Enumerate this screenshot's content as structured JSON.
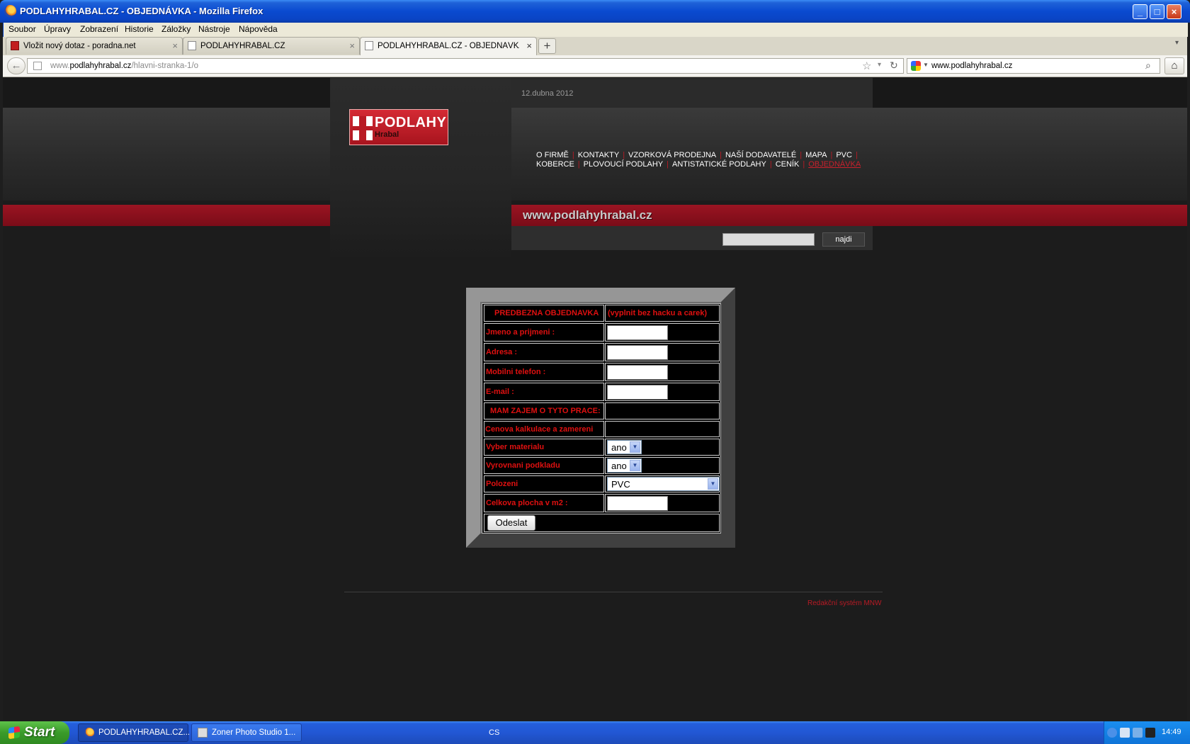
{
  "window": {
    "title": "PODLAHYHRABAL.CZ - OBJEDNÁVKA - Mozilla Firefox",
    "buttons": {
      "minimize": "_",
      "maximize": "□",
      "close": "×"
    }
  },
  "menubar": [
    "Soubor",
    "Úpravy",
    "Zobrazení",
    "Historie",
    "Záložky",
    "Nástroje",
    "Nápověda"
  ],
  "tabs": [
    {
      "label": "Vložit nový dotaz - poradna.net",
      "close": "×"
    },
    {
      "label": "PODLAHYHRABAL.CZ",
      "close": "×"
    },
    {
      "label": "PODLAHYHRABAL.CZ - OBJEDNÁVKA",
      "close": "×"
    }
  ],
  "newtab_label": "+",
  "navbar": {
    "url_prefix": "www.",
    "url_host": "podlahyhrabal.cz",
    "url_path": "/hlavni-stranka-1/o",
    "search_value": "www.podlahyhrabal.cz",
    "icons": {
      "back": "←",
      "star": "☆",
      "dropdown": "▾",
      "reload": "↻",
      "search": "⌕",
      "home": "⌂"
    }
  },
  "site": {
    "date": "12.dubna 2012",
    "logo": {
      "word1": "PODLAHY",
      "word2": "Hrabal"
    },
    "nav_row1": [
      "O FIRMĚ",
      "KONTAKTY",
      "VZORKOVÁ PRODEJNA",
      "NAŠÍ DODAVATELÉ",
      "MAPA",
      "PVC"
    ],
    "nav_row2": [
      "KOBERCE",
      "PLOVOUCÍ PODLAHY",
      "ANTISTATICKÉ PODLAHY",
      "CENÍK",
      "OBJEDNÁVKA"
    ],
    "separator": "|",
    "site_url": "www.podlahyhrabal.cz",
    "search_button": "najdi",
    "credit": "Redakční systém MNW",
    "accent_color": "#b81a24"
  },
  "form": {
    "header_left": "PREDBEZNA OBJEDNAVKA",
    "header_right": "(vyplnit bez hacku a carek)",
    "labels": {
      "name": "Jmeno a prijmeni :",
      "address": "Adresa :",
      "phone": "Mobilni telefon :",
      "email": "E-mail :",
      "interest_header": "MAM ZAJEM O TYTO PRACE:",
      "calc": "Cenova kalkulace a zamereni",
      "material": "Vyber materialu",
      "leveling": "Vyrovnani podkladu",
      "laying": "Polozeni",
      "area": "Celkova plocha v m2 :"
    },
    "values": {
      "name": "",
      "address": "",
      "phone": "",
      "email": "",
      "area": "",
      "material": "ano",
      "leveling": "ano",
      "laying": "PVC"
    },
    "dropdown_arrow": "▼",
    "submit": "Odeslat"
  },
  "taskbar": {
    "start": "Start",
    "items": [
      {
        "label": "PODLAHYHRABAL.CZ..."
      },
      {
        "label": "Zoner Photo Studio 1..."
      }
    ],
    "language": "CS",
    "clock": "14:49"
  }
}
